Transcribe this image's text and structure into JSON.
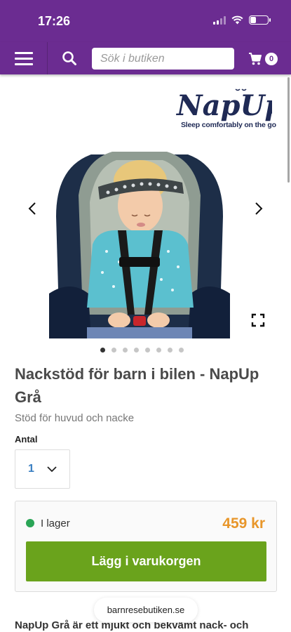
{
  "status_bar": {
    "time": "17:26"
  },
  "header": {
    "search_placeholder": "Sök i butiken",
    "cart_count": "0"
  },
  "brand": {
    "logo_text": "NapUp",
    "tagline": "Sleep comfortably on the go"
  },
  "gallery": {
    "image_count": 8,
    "active_index": 0
  },
  "product": {
    "title": "Nackstöd för barn i bilen - NapUp Grå",
    "subtitle": "Stöd för huvud och nacke",
    "quantity_label": "Antal",
    "quantity_value": "1",
    "stock_status": "I lager",
    "price": "459 kr",
    "add_to_cart_label": "Lägg i varukorgen",
    "description_start": "NapUp Grå är ett mjukt och bekvämt nack- och"
  },
  "browser": {
    "url": "barnresebutiken.se"
  },
  "colors": {
    "brand_purple": "#6b2c91",
    "button_green": "#6aa31c",
    "price_orange": "#e8962a",
    "stock_green": "#2aa556"
  }
}
